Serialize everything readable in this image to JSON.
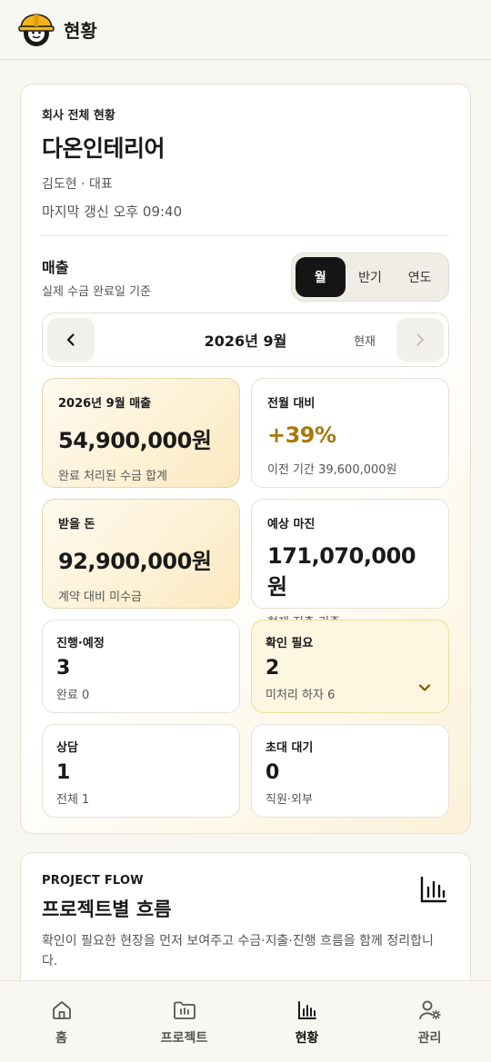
{
  "header": {
    "title": "현황"
  },
  "company": {
    "label": "회사 전체 현황",
    "name": "다온인테리어",
    "owner": "김도현 · 대표",
    "updated": "마지막 갱신 오후 09:40"
  },
  "revenue": {
    "title": "매출",
    "subtitle": "실제 수금 완료일 기준",
    "segments": [
      {
        "label": "월",
        "active": true
      },
      {
        "label": "반기",
        "active": false
      },
      {
        "label": "연도",
        "active": false
      }
    ]
  },
  "period": {
    "label": "2026년 9월",
    "now_label": "현재"
  },
  "stats": [
    {
      "label": "2026년 9월 매출",
      "value": "54,900,000원",
      "sub": "완료 처리된 수금 합계"
    },
    {
      "label": "전월 대비",
      "value": "+39%",
      "sub": "이전 기간 39,600,000원"
    },
    {
      "label": "받을 돈",
      "value": "92,900,000원",
      "sub": "계약 대비 미수금"
    },
    {
      "label": "예상 마진",
      "value": "171,070,000원",
      "sub": "현재 지출 기준"
    }
  ],
  "mini": [
    {
      "label": "진행·예정",
      "value": "3",
      "sub": "완료 0"
    },
    {
      "label": "확인 필요",
      "value": "2",
      "sub": "미처리 하자 6"
    },
    {
      "label": "상담",
      "value": "1",
      "sub": "전체 1"
    },
    {
      "label": "초대 대기",
      "value": "0",
      "sub": "직원·외부"
    }
  ],
  "flow": {
    "eyebrow": "PROJECT FLOW",
    "title": "프로젝트별 흐름",
    "description": "확인이 필요한 현장을 먼저 보여주고 수금·지출·진행 흐름을 함께 정리합니다."
  },
  "nav": [
    {
      "label": "홈",
      "icon": "home-icon"
    },
    {
      "label": "프로젝트",
      "icon": "folder-icon"
    },
    {
      "label": "현황",
      "icon": "bar-chart-icon"
    },
    {
      "label": "관리",
      "icon": "user-settings-icon"
    }
  ],
  "colors": {
    "accent": "#a8790b",
    "dark": "#151515",
    "gold_bg": "#fdf1d4"
  }
}
